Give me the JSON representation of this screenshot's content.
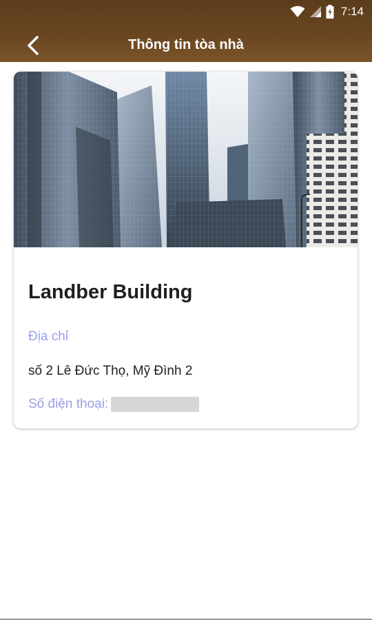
{
  "status_bar": {
    "time": "7:14",
    "icons": [
      "wifi-icon",
      "signal-icon",
      "battery-icon"
    ]
  },
  "app_bar": {
    "title": "Thông tin tòa nhà",
    "back_icon": "chevron-left-icon",
    "background": "#6b4722"
  },
  "building": {
    "name": "Landber Building",
    "address_label": "Địa chỉ",
    "address": "số 2 Lê Đức Thọ, Mỹ Đình 2",
    "phone_label": "Số điện thoại:",
    "phone": ""
  },
  "colors": {
    "label": "#9aa0e6",
    "text": "#222222"
  }
}
